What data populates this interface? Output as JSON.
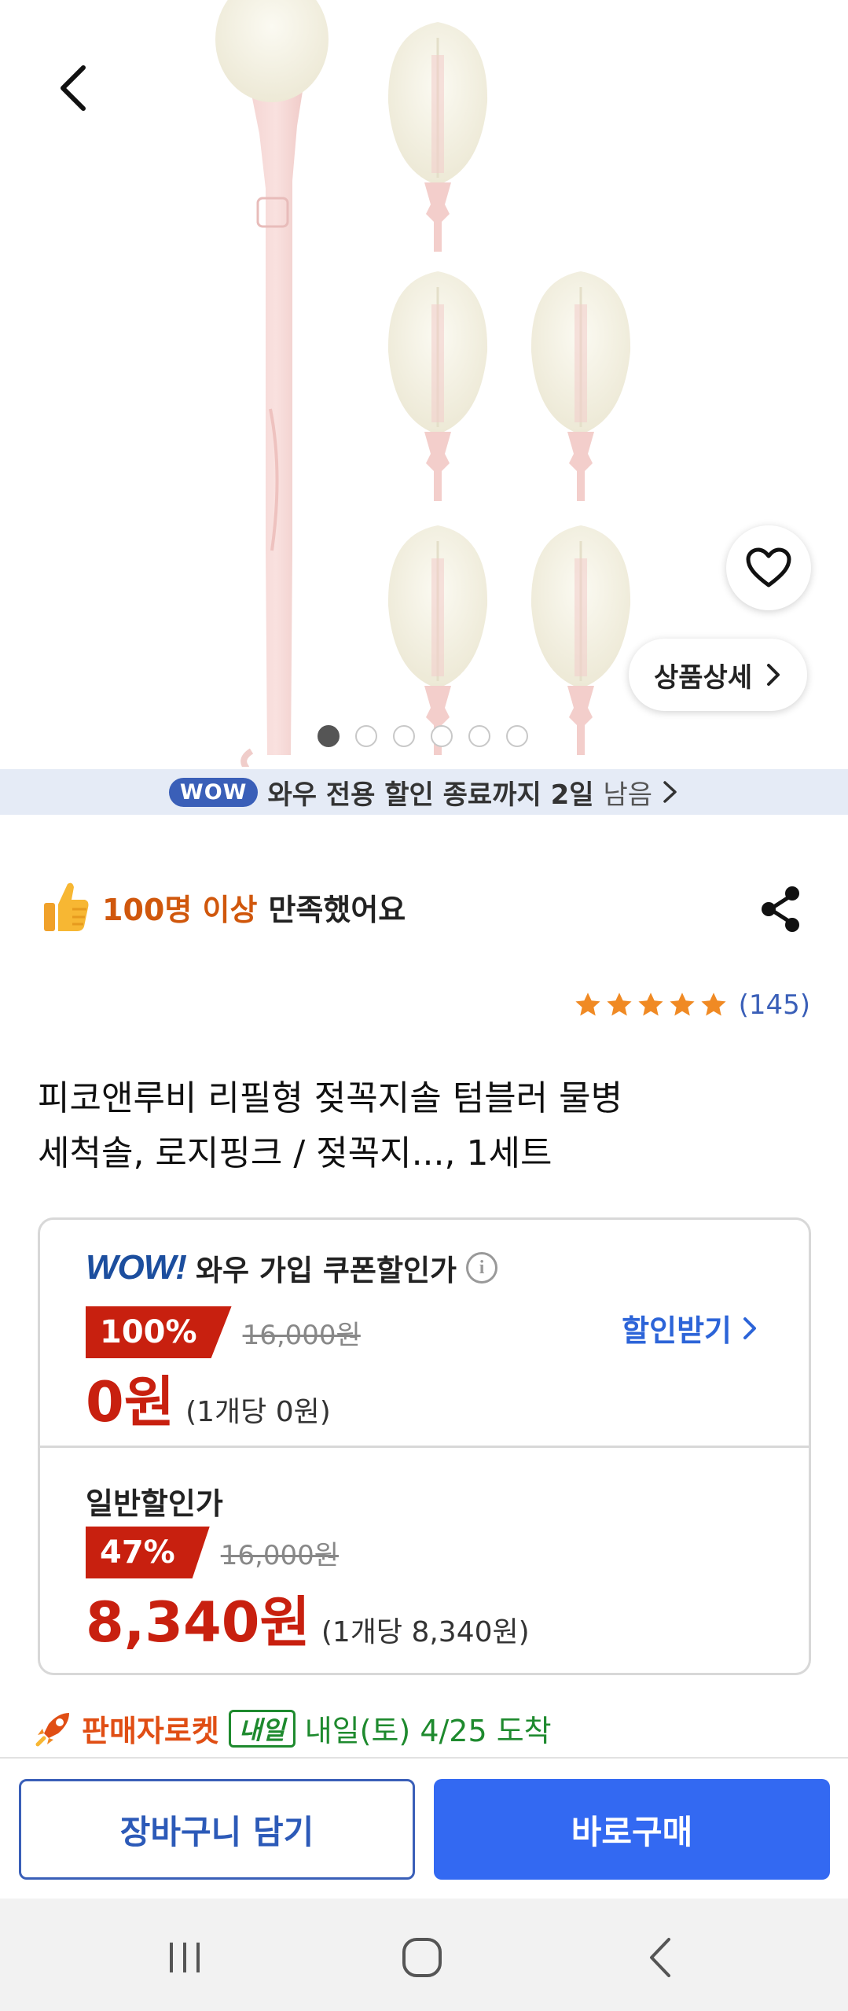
{
  "gallery": {
    "dots_total": 6,
    "active_index": 0,
    "detail_button_label": "상품상세"
  },
  "wow_banner": {
    "badge": "WOW",
    "text": "와우 전용 할인 종료까지 2일",
    "suffix": "남음"
  },
  "satisfaction": {
    "count_text": "100명 이상",
    "rest_text": "만족했어요"
  },
  "rating": {
    "stars": 5,
    "count_text": "(145)",
    "star_color": "#f08a24"
  },
  "product": {
    "title_line1": "피코앤루비 리필형 젖꼭지솔 텀블러 물병",
    "title_line2": "세척솔, 로지핑크 / 젖꼭지..., 1세트"
  },
  "wow_price": {
    "logo": "WOW!",
    "label": "와우 가입 쿠폰할인가",
    "discount": "100%",
    "original": "16,000원",
    "final": "0원",
    "unit": "(1개당 0원)",
    "coupon_button": "할인받기"
  },
  "normal_price": {
    "label": "일반할인가",
    "discount": "47%",
    "original": "16,000원",
    "final": "8,340원",
    "unit": "(1개당 8,340원)"
  },
  "delivery": {
    "seller_rocket": "판매자로켓",
    "tomorrow_badge": "내일",
    "eta": "내일(토) 4/25 도착"
  },
  "actions": {
    "cart_label": "장바구니 담기",
    "buy_label": "바로구매"
  },
  "colors": {
    "accent_blue": "#3369f2",
    "discount_red": "#c8200f",
    "rocket_orange": "#e04e14",
    "delivery_green": "#1e8a2e"
  }
}
